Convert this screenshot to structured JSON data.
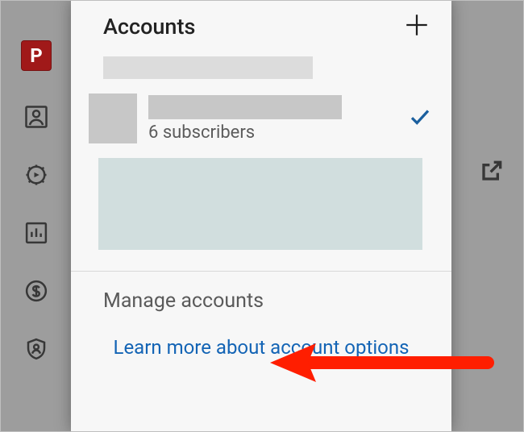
{
  "sidebar": {
    "badge_letter": "P"
  },
  "panel": {
    "title": "Accounts",
    "current_account": {
      "subscribers_text": "6 subscribers"
    },
    "manage_label": "Manage accounts",
    "learn_more_label": "Learn more about account options"
  }
}
